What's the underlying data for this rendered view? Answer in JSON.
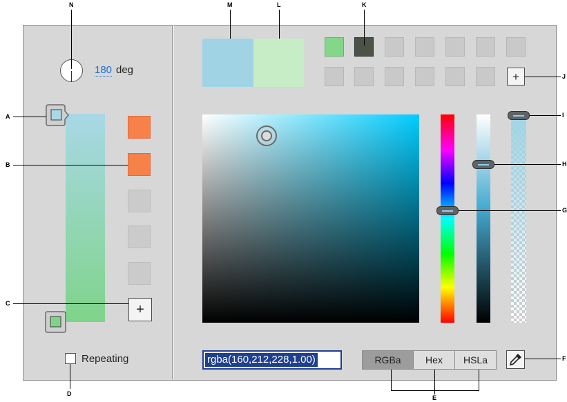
{
  "callouts": {
    "a": "A",
    "b": "B",
    "c": "C",
    "d": "D",
    "e": "E",
    "f": "F",
    "g": "G",
    "h": "H",
    "i": "I",
    "j": "J",
    "k": "K",
    "l": "L",
    "m": "M",
    "n": "N"
  },
  "gradient": {
    "angle_value": "180",
    "angle_unit": "deg",
    "repeating_label": "Repeating",
    "add_stop_icon": "+"
  },
  "picker": {
    "color_value": "rgba(160,212,228,1.00)",
    "modes": [
      "RGBa",
      "Hex",
      "HSLa"
    ],
    "active_mode": "RGBa",
    "add_swatch_icon": "+"
  },
  "colors": {
    "stop_top": "#a8d8e6",
    "stop_bottom": "#7fd48a",
    "current": "#a0d4e4",
    "previous": "#c7edc7",
    "accent_link": "#1f6fd1",
    "input_border": "#1f3f8f"
  },
  "icons": [
    "angle-dial-icon",
    "eyedropper-icon",
    "plus-icon"
  ]
}
